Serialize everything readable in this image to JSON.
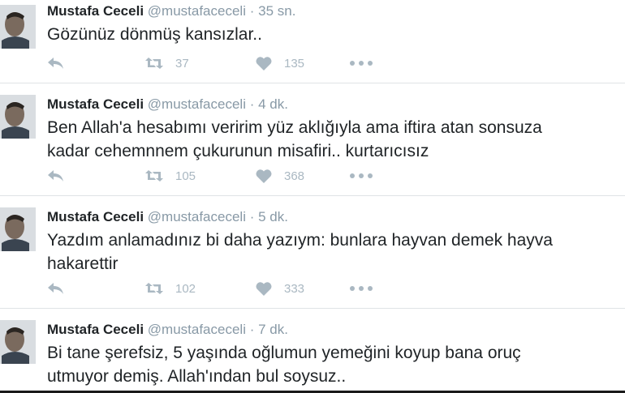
{
  "tweets": [
    {
      "name": "Mustafa Ceceli",
      "handle": "@mustafaceceli",
      "separator": "·",
      "time": "35 sn.",
      "lines": [
        "Gözünüz dönmüş kansızlar.."
      ],
      "retweets": "37",
      "likes": "135"
    },
    {
      "name": "Mustafa Ceceli",
      "handle": "@mustafaceceli",
      "separator": "·",
      "time": "4 dk.",
      "lines": [
        "Ben Allah'a hesabımı veririm yüz aklığıyla ama iftira atan sonsuza",
        "kadar cehemnnem çukurunun misafiri.. kurtarıcısız"
      ],
      "retweets": "105",
      "likes": "368"
    },
    {
      "name": "Mustafa Ceceli",
      "handle": "@mustafaceceli",
      "separator": "·",
      "time": "5 dk.",
      "lines": [
        "Yazdım anlamadınız bi daha yazıym: bunlara hayvan demek hayva",
        "hakarettir"
      ],
      "retweets": "102",
      "likes": "333"
    },
    {
      "name": "Mustafa Ceceli",
      "handle": "@mustafaceceli",
      "separator": "·",
      "time": "7 dk.",
      "lines": [
        "Bi tane şerefsiz, 5 yaşında oğlumun yemeğini koyup bana oruç",
        "utmuyor demiş. Allah'ından bul soysuz.."
      ]
    }
  ],
  "icons": {
    "reply": "reply-icon",
    "retweet": "retweet-icon",
    "like": "heart-icon",
    "more": "more-icon"
  },
  "colors": {
    "name": "#1f2326",
    "meta": "#8899a6",
    "action": "#aab8c2",
    "divider": "#dfe3e6"
  }
}
